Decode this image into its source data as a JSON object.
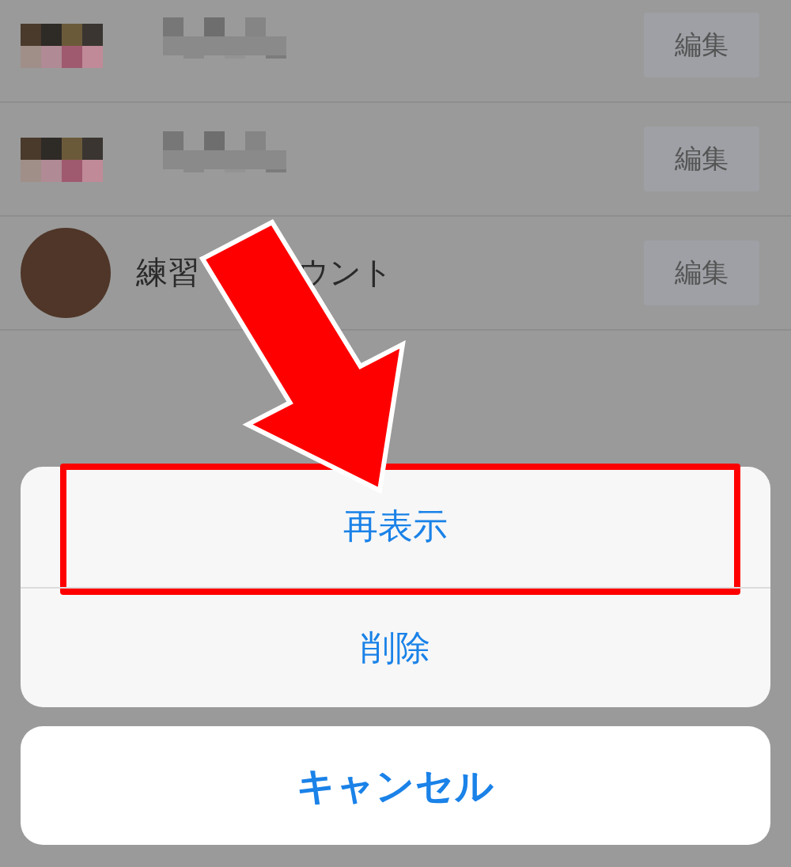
{
  "accounts": [
    {
      "kind": "pixelated",
      "edit_label": "編集"
    },
    {
      "kind": "pixelated",
      "edit_label": "編集"
    },
    {
      "kind": "named",
      "name_parts": [
        "練習",
        "ウント"
      ],
      "edit_label": "編集"
    }
  ],
  "action_sheet": {
    "actions": [
      {
        "label": "再表示",
        "highlighted": true
      },
      {
        "label": "削除",
        "highlighted": false
      }
    ],
    "cancel": "キャンセル"
  }
}
